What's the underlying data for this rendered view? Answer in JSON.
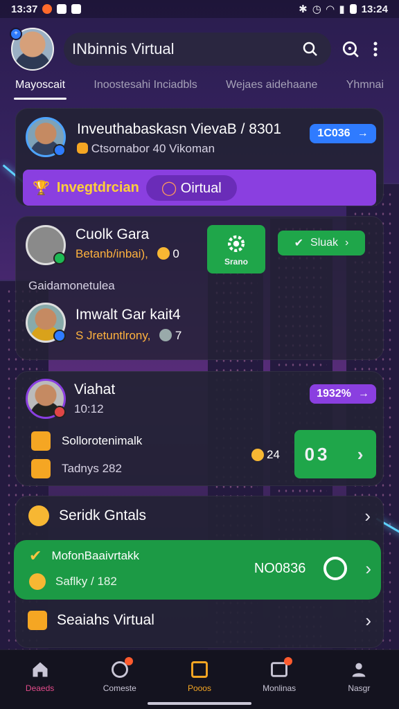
{
  "status": {
    "time_left": "13:37",
    "time_right": "13:24"
  },
  "search": {
    "title": "INbinnis Virtual"
  },
  "tabs": [
    "Mayoscait",
    "Inoostesahi Inciadbls",
    "Wejaes aidehaane",
    "Yhmnai"
  ],
  "profile_card": {
    "title": "Inveuthabaskasn VievaB / 8301",
    "subtitle": "Ctsornabor 40 Vikoman",
    "badge": "1C036",
    "banner_left": "Invegtdrcian",
    "banner_right": "Oirtual"
  },
  "game_card": {
    "player1_name": "Cuolk Gara",
    "player1_sub": "Betanb/inbai),",
    "player1_value": "0",
    "action_button": "Srano",
    "action_pill": "Sluak",
    "section_label": "Gaidamonetulea",
    "player2_name": "Imwalt Gar kait4",
    "player2_sub": "S Jretuntlrony,",
    "player2_value": "7"
  },
  "stats_card": {
    "name": "Viahat",
    "time": "10:12",
    "badge": "1932%",
    "row1_label": "Sollorotenimalk",
    "row2_label": "Tadnys 282",
    "coin_value": "24",
    "score": "03"
  },
  "menu": {
    "item1": "Seridk Gntals",
    "green_title": "MofonBaaivrtakk",
    "green_sub": "Saflky / 182",
    "green_value": "NO0836",
    "item3": "Seaiahs Virtual"
  },
  "nav": [
    "Deaeds",
    "Comeste",
    "Pooos",
    "Monlinas",
    "Nasgr"
  ],
  "colors": {
    "accent_orange": "#f5a623",
    "accent_green": "#1fa64a",
    "accent_purple": "#8a3fe0",
    "accent_blue": "#2f7bff"
  }
}
